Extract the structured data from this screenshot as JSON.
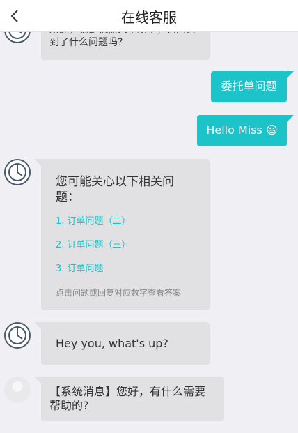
{
  "header": {
    "title": "在线客服"
  },
  "messages": {
    "welcome": "欢迎，我是机器人小助手，请问遇到了什么问题吗?",
    "sent_1": "委托单问题",
    "sent_2": "Hello Miss 😃",
    "faq": {
      "title": "您可能关心以下相关问题：",
      "items": [
        "1. 订单问题（二）",
        "2. 订单问题（三）",
        "3. 订单问题"
      ],
      "hint": "点击问题或回复对应数字查看答案"
    },
    "bot_reply": "Hey you, what's up?",
    "system": "【系统消息】您好，有什么需要帮助的?"
  },
  "colors": {
    "accent": "#1cc3c9",
    "bubble_left": "#e1e1e4",
    "background": "#efeff4"
  }
}
